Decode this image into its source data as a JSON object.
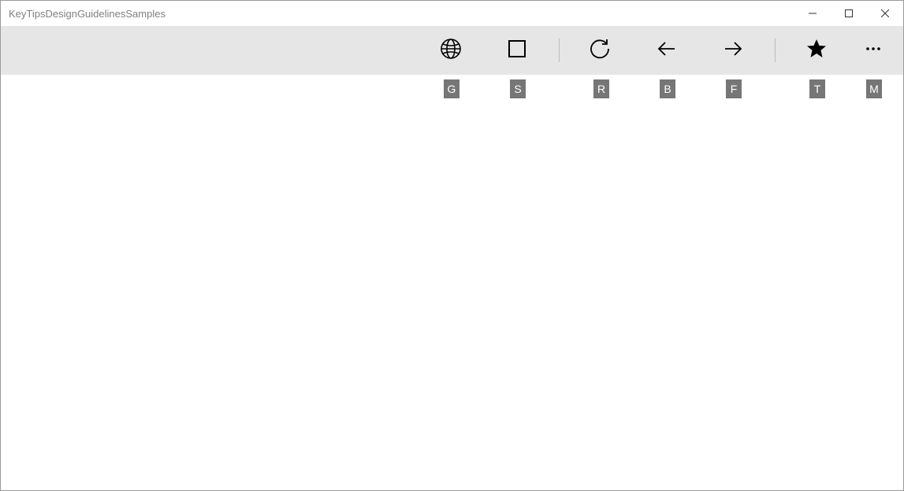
{
  "window": {
    "title": "KeyTipsDesignGuidelinesSamples"
  },
  "toolbar": {
    "items": [
      {
        "name": "globe",
        "keytip": "G"
      },
      {
        "name": "stop",
        "keytip": "S"
      },
      {
        "name": "refresh",
        "keytip": "R"
      },
      {
        "name": "back",
        "keytip": "B"
      },
      {
        "name": "forward",
        "keytip": "F"
      },
      {
        "name": "star",
        "keytip": "T"
      },
      {
        "name": "more",
        "keytip": "M"
      }
    ]
  }
}
